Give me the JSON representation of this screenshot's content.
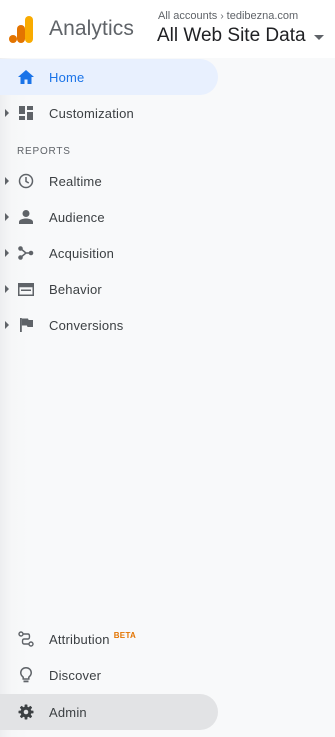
{
  "header": {
    "app_name": "Analytics",
    "account_prefix": "All accounts",
    "account_name": "tedibezna.com",
    "property": "All Web Site Data"
  },
  "nav": {
    "home": "Home",
    "customization": "Customization",
    "reports_title": "REPORTS",
    "realtime": "Realtime",
    "audience": "Audience",
    "acquisition": "Acquisition",
    "behavior": "Behavior",
    "conversions": "Conversions",
    "attribution": "Attribution",
    "attribution_badge": "BETA",
    "discover": "Discover",
    "admin": "Admin"
  },
  "colors": {
    "accent": "#1a73e8",
    "logo_orange_dark": "#e37400",
    "logo_orange_light": "#f9ab00",
    "beta": "#e37400"
  }
}
